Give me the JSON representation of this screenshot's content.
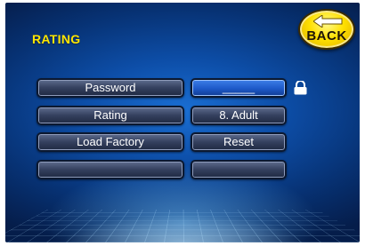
{
  "screen": {
    "title": "RATING"
  },
  "back_button": {
    "label": "BACK",
    "icon": "left-arrow-icon"
  },
  "rows": [
    {
      "label": "Password",
      "value": "_____"
    },
    {
      "label": "Rating",
      "value": "8. Adult"
    },
    {
      "label": "Load Factory",
      "value": "Reset"
    },
    {
      "label": "",
      "value": ""
    }
  ],
  "lock_icon": "lock-icon",
  "colors": {
    "title": "#ffe600",
    "back_button": "#ffe000",
    "active_field": "#2a66d6"
  }
}
